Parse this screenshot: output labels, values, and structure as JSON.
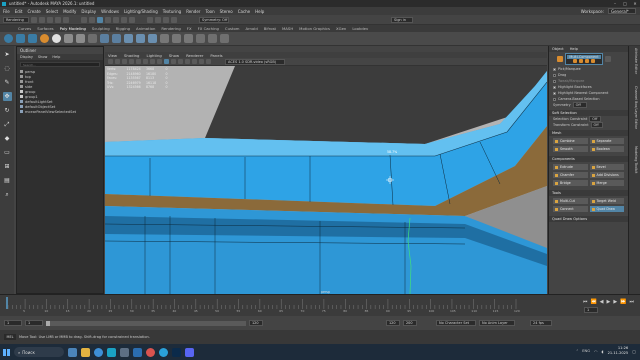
{
  "window": {
    "title": "untitled* - Autodesk MAYA 2026.1: untitled",
    "controls": [
      "–",
      "□",
      "✕"
    ]
  },
  "menubar": {
    "items": [
      "File",
      "Edit",
      "Create",
      "Select",
      "Modify",
      "Display",
      "Windows",
      "Lighting/Shading",
      "Texturing",
      "Render",
      "Toon",
      "Stereo",
      "Cache",
      "Help"
    ],
    "workspace_label": "Workspace:",
    "workspace_value": "General*"
  },
  "statusline": {
    "menuset": "Rendering",
    "symmetry_label": "Symmetry: Off",
    "signin": "Sign in"
  },
  "shelf": {
    "tabs": [
      "Curves",
      "Surfaces",
      "Poly Modeling",
      "Sculpting",
      "Rigging",
      "Animation",
      "Rendering",
      "FX",
      "FX Caching",
      "Custom",
      "Arnold",
      "Bifrost",
      "MASH",
      "Motion Graphics",
      "XGen",
      "Lookdev"
    ],
    "active_tab": "Poly Modeling"
  },
  "outliner": {
    "title": "Outliner",
    "menu": [
      "Display",
      "Show",
      "Help"
    ],
    "search_placeholder": "Search...",
    "items": [
      {
        "label": "persp",
        "depth": 0
      },
      {
        "label": "top",
        "depth": 0
      },
      {
        "label": "front",
        "depth": 0
      },
      {
        "label": "side",
        "depth": 0
      },
      {
        "label": "group",
        "depth": 0
      },
      {
        "label": "group1",
        "depth": 0
      },
      {
        "label": "defaultLightSet",
        "depth": 0
      },
      {
        "label": "defaultObjectSet",
        "depth": 0
      },
      {
        "label": "mcearPanelViewSelectedSet",
        "depth": 0
      }
    ]
  },
  "viewport": {
    "menu": [
      "View",
      "Shading",
      "Lighting",
      "Show",
      "Renderer",
      "Panels"
    ],
    "colorspace": "ACES 1.0 SDR-video (sRGB)",
    "hud": [
      {
        "name": "Verts:",
        "a": "1178424",
        "b": "3668",
        "c": "0"
      },
      {
        "name": "Edges:",
        "a": "2148960",
        "b": "16180",
        "c": "0"
      },
      {
        "name": "Faces:",
        "a": "1135567",
        "b": "8113",
        "c": "0"
      },
      {
        "name": "Tris:",
        "a": "2246979",
        "b": "16118",
        "c": "0"
      },
      {
        "name": "UVs:",
        "a": "1324566",
        "b": "8768",
        "c": "0"
      }
    ],
    "camera_label": "persp",
    "edge_readout": "58.7%"
  },
  "toolkit": {
    "tabs": [
      "Object",
      "Help"
    ],
    "mode_label": "Multi-Component",
    "options": [
      {
        "label": "Pick/Marquee",
        "on": true
      },
      {
        "label": "Drag",
        "on": false
      },
      {
        "label": "Tweak/Marquee",
        "on": false
      },
      {
        "label": "Highlight Backfaces",
        "on": true
      },
      {
        "label": "Highlight Nearest Component",
        "on": true
      }
    ],
    "camera_based": "Camera-Based Selection",
    "symmetry": "Symmetry",
    "symmetry_value": "Off",
    "soft_selection": "Soft Selection",
    "selection_constraint": "Selection Constraint",
    "selection_constraint_value": "Off",
    "transform_constraint": "Transform Constraint",
    "transform_constraint_value": "Off",
    "sections": [
      {
        "title": "Mesh",
        "buttons": [
          "Combine",
          "Separate",
          "Smooth",
          "Boolean"
        ]
      },
      {
        "title": "Components",
        "buttons": [
          "Extrude",
          "Bevel",
          "Chamfer",
          "Bridge",
          "Add Divisions",
          "Merge"
        ]
      },
      {
        "title": "Tools",
        "buttons": [
          "Multi-Cut",
          "Target Weld",
          "Connect",
          "Quad Draw"
        ]
      }
    ],
    "quad_draw_options": "Quad Draw Options"
  },
  "cbstrip_labels": [
    "Attribute Editor",
    "Channel Box/Layer Editor",
    "Modeling Toolkit"
  ],
  "timeslider": {
    "ticks": [
      "5",
      "10",
      "15",
      "20",
      "25",
      "30",
      "35",
      "40",
      "45",
      "50",
      "55",
      "60",
      "65",
      "70",
      "75",
      "80",
      "85",
      "90",
      "95",
      "100",
      "105",
      "110",
      "115",
      "120"
    ],
    "current_frame": "1"
  },
  "rangeslider": {
    "start": "1",
    "start2": "1",
    "end": "120",
    "end2": "120",
    "end3": "200",
    "character_set": "No Character Set",
    "anim_layer": "No Anim Layer",
    "fps": "24 fps"
  },
  "helpline": {
    "mel": "MEL",
    "text": "Move Tool: Use LMB or MMB to drag. Shift-drag for constrained translation."
  },
  "taskbar": {
    "search": "Поиск",
    "time": "11:26",
    "date": "21.11.2025",
    "lang": "ENG"
  },
  "colors": {
    "mesh": "#2ea3e6",
    "selection": "#5285a6",
    "edge_highlight": "#41e07a"
  }
}
